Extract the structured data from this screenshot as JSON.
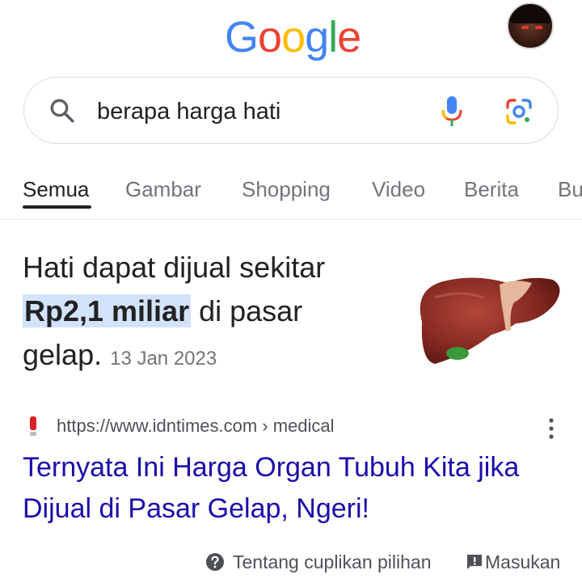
{
  "header": {
    "logo_letters": [
      "G",
      "o",
      "o",
      "g",
      "l",
      "e"
    ],
    "avatar": "user-avatar"
  },
  "search": {
    "query": "berapa harga hati",
    "icons": [
      "search-icon",
      "microphone-icon",
      "google-lens-icon"
    ]
  },
  "tabs": [
    {
      "label": "Semua",
      "active": true
    },
    {
      "label": "Gambar",
      "active": false
    },
    {
      "label": "Shopping",
      "active": false
    },
    {
      "label": "Video",
      "active": false
    },
    {
      "label": "Berita",
      "active": false
    },
    {
      "label": "Bu",
      "active": false
    }
  ],
  "snippet": {
    "text_before": "Hati dapat dijual sekitar ",
    "highlight": "Rp2,1 miliar",
    "text_after": " di pasar gelap.",
    "date": "13 Jan 2023",
    "image": "liver-image"
  },
  "result": {
    "url": "https://www.idntimes.com › medical",
    "title": "Ternyata Ini Harga Organ Tubuh Kita jika Dijual di Pasar Gelap, Ngeri!",
    "menu_icon": "more-vert-icon"
  },
  "footer": {
    "about_label": "Tentang cuplikan pilihan",
    "feedback_label": "Masukan"
  },
  "colors": {
    "link": "#1a0dab",
    "highlight_bg": "#d3e3fd",
    "muted_text": "#70757a",
    "google_blue": "#4285F4",
    "google_red": "#EA4335",
    "google_yellow": "#FBBC05",
    "google_green": "#34A853"
  }
}
